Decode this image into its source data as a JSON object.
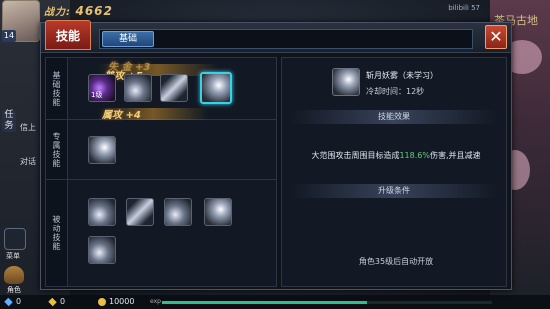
{
  "hud": {
    "power_label": "战力:",
    "power_value": "4662",
    "level": "14",
    "status": "bilibili 57",
    "map_name": "茶马古地",
    "side_tabs": [
      "任",
      "务"
    ],
    "side_labels": [
      "信上",
      "对话"
    ],
    "crosspad_label": "菜单",
    "role_label": "角色",
    "diamonds": "0",
    "bound_gold": "0",
    "gold": "10000",
    "exp_label": "exp",
    "exp_fraction": 0.62
  },
  "panel": {
    "main_tab": "技能",
    "sub_tab": "基础",
    "close_symbol": "✕"
  },
  "sections": {
    "basic_label": "基础技能",
    "exclusive_label": "专属技能",
    "passive_label": "被动技能",
    "banner_1_faded": "失 金 +3",
    "banner_1": "普攻 +5",
    "banner_2": "属攻 +4",
    "first_skill_level": "1级"
  },
  "detail": {
    "skill_name": "斩月妖雾（未学习）",
    "cooldown": "冷却时间：12秒",
    "effect_header": "技能效果",
    "effect_before": "大范围攻击周围目标造成",
    "effect_pct": "118.6%",
    "effect_after": "伤害,并且减速",
    "upgrade_header": "升级条件",
    "unlock_text": "角色35级后自动开放"
  },
  "colors": {
    "accent_cyan": "#3ad0e8",
    "tab_red": "#b83a2a",
    "effect_green": "#5ad07a",
    "gold_text": "#f0d080"
  }
}
